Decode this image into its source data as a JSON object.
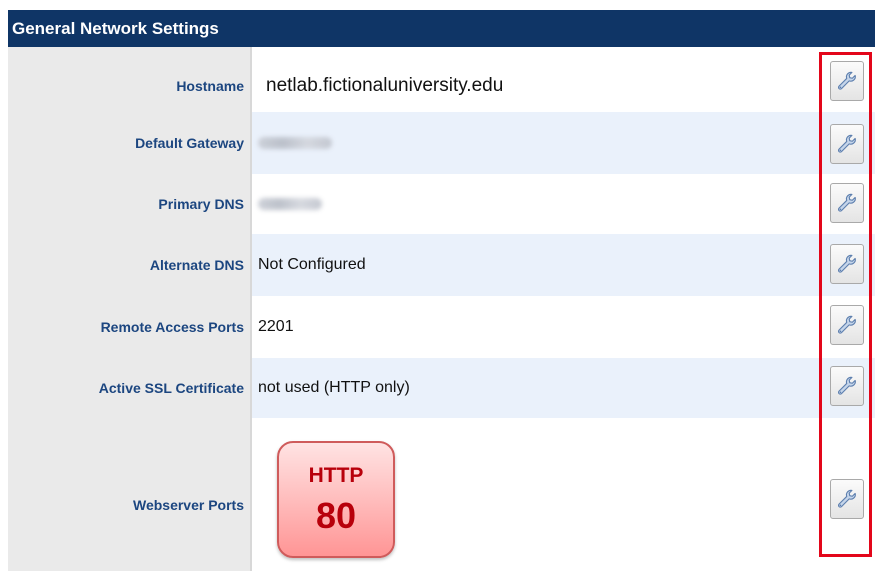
{
  "panel": {
    "title": "General Network Settings"
  },
  "settings": [
    {
      "label": "Hostname",
      "value": "netlab.fictionaluniversity.edu",
      "redacted": false
    },
    {
      "label": "Default Gateway",
      "value": "",
      "redacted": true
    },
    {
      "label": "Primary DNS",
      "value": "",
      "redacted": true
    },
    {
      "label": "Alternate DNS",
      "value": "Not Configured",
      "redacted": false
    },
    {
      "label": "Remote Access Ports",
      "value": "2201",
      "redacted": false
    },
    {
      "label": "Active SSL Certificate",
      "value": "not used (HTTP only)",
      "redacted": false
    },
    {
      "label": "Webserver Ports",
      "value": "",
      "redacted": false
    }
  ],
  "webserver_badge": {
    "protocol": "HTTP",
    "port": "80"
  },
  "icons": {
    "edit_button": "wrench-icon"
  },
  "colors": {
    "header_bg": "#0f3566",
    "label_text": "#1c4680",
    "highlight_border": "#e3061a",
    "badge_text": "#b8000b"
  }
}
